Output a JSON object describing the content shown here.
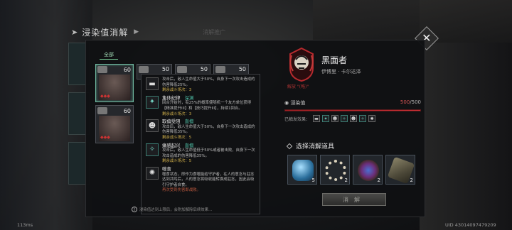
{
  "window": {
    "title": "浸染值消解",
    "faint_label": "消解推广"
  },
  "tabs": {
    "all": "全部"
  },
  "slots": [
    {
      "count": "60",
      "selected": true
    },
    {
      "count": "50",
      "selected": false
    },
    {
      "count": "50",
      "selected": false
    },
    {
      "count": "50",
      "selected": false
    },
    {
      "count": "60",
      "selected": false
    }
  ],
  "tooltip": {
    "entries": [
      {
        "name": "",
        "grade": "",
        "desc": "攻击后，敌人生命值大于50%，自身下一次攻击造成的伤害降低25%。",
        "remain": "剩余战斗场次：3"
      },
      {
        "name": "集体纪律",
        "grade": "深渊",
        "desc": "回合开始时，有25%的概率使随机一个友方单位获得【精准提升III】和【技巧提升III】，持续1回合。",
        "remain": "剩余战斗场次：3"
      },
      {
        "name": "取偏受阻",
        "grade": "直擅",
        "desc": "攻击后，敌人生命值大于50%，自身下一次攻击造成的伤害降低35%。",
        "remain": "剩余战斗场次：5"
      },
      {
        "name": "痛感起兴",
        "grade": "直擅",
        "desc": "攻击后，敌人生命值低于50%或者被击败，自身下一次攻击造成的伤害降低35%。",
        "remain": "剩余战斗场次：5"
      },
      {
        "name": "噬食",
        "grade": "",
        "desc": "噬食状态，即作为食噬能给守护者，在人的意念与驻念达到共鸣后，人的意念将吸收能转换成驻念，因此会吸引守护者自食。",
        "remain": "",
        "hint": "再次受到伤害即战败。"
      }
    ],
    "footer": "浸染值达到上限后，会附加解除后续效果…"
  },
  "character": {
    "name": "黑面者",
    "subtitle": "伊博里 · 卡尔达泽",
    "emblem_label": "解放 \"(略)\"",
    "taint_label": "浸染值",
    "taint_current": "500",
    "taint_max": "/500",
    "taint_fraction": 1.0,
    "effects_label": "已触发效果："
  },
  "items_section": {
    "title": "选择消解道具",
    "items": [
      {
        "name": "crystal-vial-icon",
        "count": "5"
      },
      {
        "name": "tooth-necklace-icon",
        "count": "2"
      },
      {
        "name": "amulet-icon",
        "count": "2"
      },
      {
        "name": "cloth-bundle-icon",
        "count": "2"
      }
    ],
    "dissolve_button": "消解"
  },
  "status": {
    "latency": "113ms",
    "uid": "UID 43014097479209"
  },
  "colors": {
    "accent_red": "#d03036",
    "accent_teal": "#4fc1a8",
    "panel_bg": "#101113"
  }
}
